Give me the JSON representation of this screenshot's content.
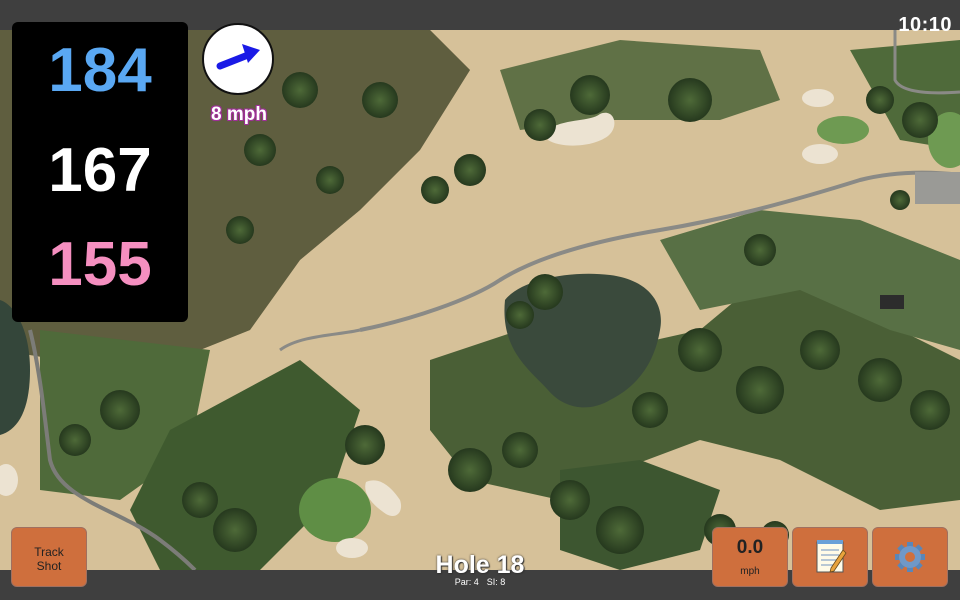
{
  "status": {
    "time": "10:10"
  },
  "yardages": {
    "back": "184",
    "middle": "167",
    "front": "155"
  },
  "wind": {
    "speed_label": "8 mph",
    "arrow_icon": "wind-arrow-icon",
    "arrow_color": "#1a1ae6"
  },
  "buttons": {
    "track_shot": {
      "line1": "Track",
      "line2": "Shot"
    },
    "speed": {
      "value": "0.0",
      "unit": "mph"
    },
    "notes": {
      "icon": "notepad-icon"
    },
    "settings": {
      "icon": "gear-icon"
    }
  },
  "hole": {
    "title": "Hole 18",
    "par": "Par: 4",
    "si": "SI: 8"
  },
  "colors": {
    "accent_button": "#cf6f3d",
    "yardage_back": "#5aa8f3",
    "yardage_middle": "#ffffff",
    "yardage_front": "#f58fc0"
  }
}
